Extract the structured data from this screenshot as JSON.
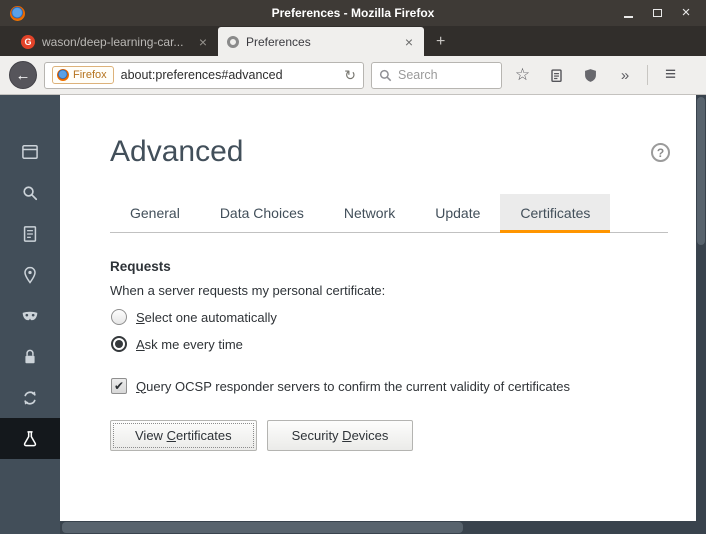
{
  "window": {
    "title": "Preferences - Mozilla Firefox"
  },
  "icons": {
    "close": "×",
    "back": "←",
    "reload": "↻",
    "star": "☆",
    "overflow": "»",
    "menu": "≡",
    "help": "?",
    "check": "✔",
    "new_tab": "+",
    "favicon_letter": "G"
  },
  "browser_tabs": [
    {
      "title": "wason/deep-learning-car...",
      "active": false
    },
    {
      "title": "Preferences",
      "active": true
    }
  ],
  "toolbar": {
    "badge_label": "Firefox",
    "url": "about:preferences#advanced",
    "search_placeholder": "Search"
  },
  "sidebar": {
    "items": [
      "general",
      "search",
      "content",
      "applications",
      "privacy",
      "security",
      "sync",
      "advanced"
    ],
    "active": "advanced"
  },
  "content": {
    "heading": "Advanced",
    "tabs": [
      {
        "label": "General"
      },
      {
        "label": "Data Choices"
      },
      {
        "label": "Network"
      },
      {
        "label": "Update"
      },
      {
        "label": "Certificates"
      }
    ],
    "active_tab": "Certificates",
    "accent_color": "#ff9500",
    "section_title": "Requests",
    "intro": "When a server requests my personal certificate:",
    "radios": [
      {
        "pre": "",
        "key": "S",
        "post": "elect one automatically",
        "selected": false
      },
      {
        "pre": "",
        "key": "A",
        "post": "sk me every time",
        "selected": true
      }
    ],
    "checkbox": {
      "pre": "",
      "key": "Q",
      "post": "uery OCSP responder servers to confirm the current validity of certificates",
      "checked": true
    },
    "buttons": [
      {
        "pre": "View ",
        "key": "C",
        "post": "ertificates",
        "focused": true
      },
      {
        "pre": "Security ",
        "key": "D",
        "post": "evices",
        "focused": false
      }
    ]
  }
}
